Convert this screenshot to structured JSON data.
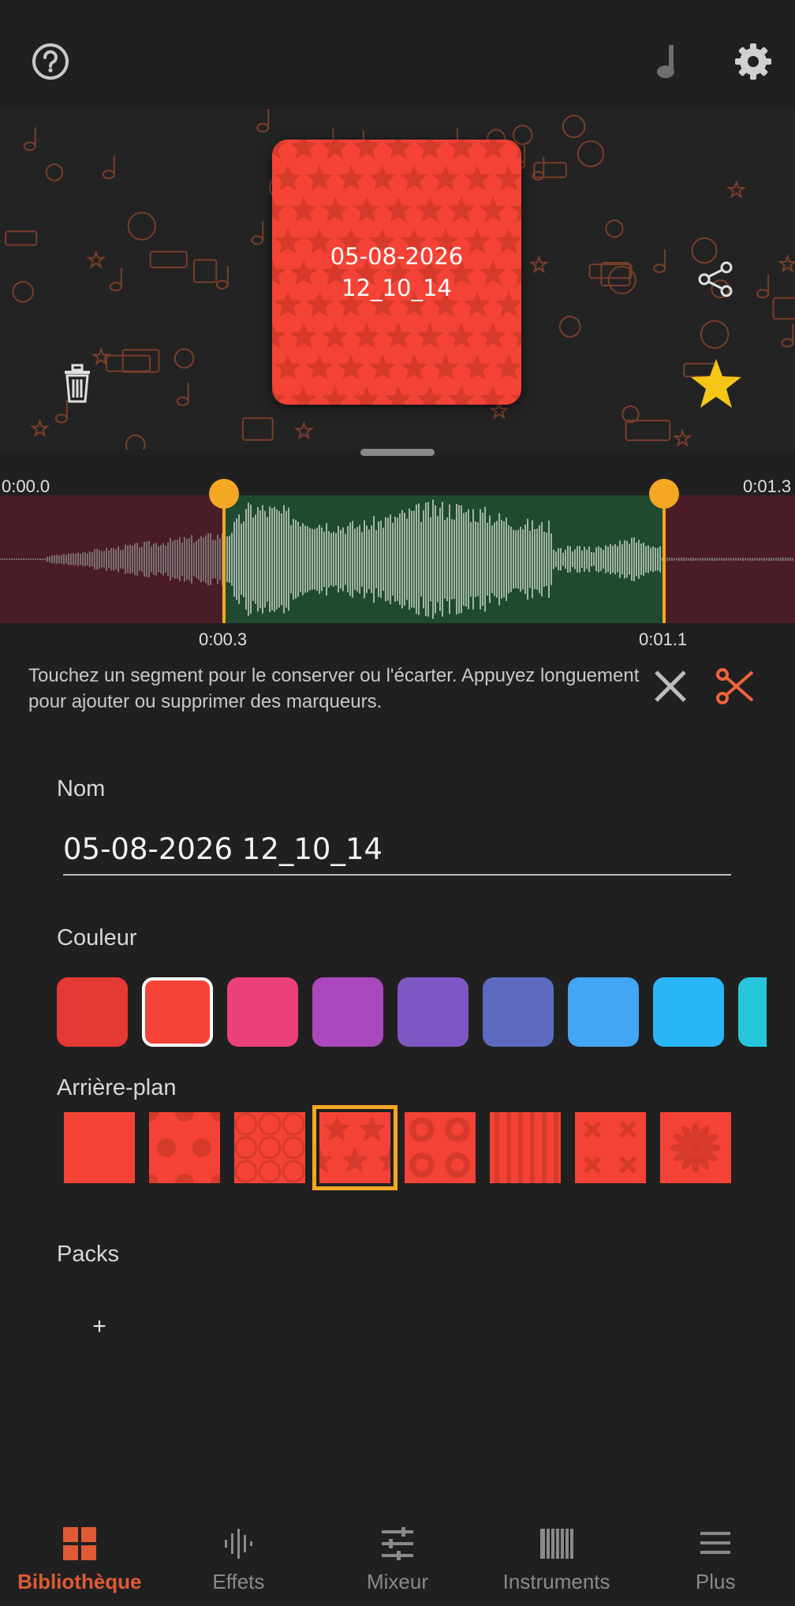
{
  "colors": {
    "accent": "#f5a623",
    "nav_active": "#e05a35",
    "cover_red": "#f44336",
    "keep_segment": "#1f4a30",
    "discard_segment": "#4a1d26",
    "scissors": "#f0643c",
    "star": "#f5c518"
  },
  "top_bar": {
    "help_icon": "help-circle-icon",
    "music_icon": "music-note-icon",
    "settings_icon": "gear-icon"
  },
  "hero": {
    "cover_line1": "05-08-2026",
    "cover_line2": "12_10_14",
    "delete_icon": "trash-icon",
    "share_icon": "share-icon",
    "favorite_icon": "star-icon"
  },
  "trim": {
    "start_time": "0:00.0",
    "end_time": "0:01.3",
    "marker_left_time": "0:00.3",
    "marker_right_time": "0:01.1",
    "hint": "Touchez un segment pour le conserver ou l'écarter. Appuyez longuement pour ajouter ou supprimer des marqueurs.",
    "cancel_icon": "close-icon",
    "cut_icon": "scissors-icon"
  },
  "form": {
    "name_label": "Nom",
    "name_value": "05-08-2026 12_10_14",
    "color_label": "Couleur",
    "colors": [
      "#e53935",
      "#f44336",
      "#ec407a",
      "#ab47bc",
      "#7e57c2",
      "#5c6bc0",
      "#42a5f5",
      "#29b6f6",
      "#26c6da"
    ],
    "selected_color_index": 1,
    "background_label": "Arrière-plan",
    "backgrounds": [
      "plain",
      "dots",
      "tiles",
      "stars",
      "circles",
      "stripes",
      "crosses",
      "flower"
    ],
    "selected_background_index": 3,
    "packs_label": "Packs",
    "packs_add": "+"
  },
  "nav": {
    "items": [
      {
        "label": "Bibliothèque",
        "icon": "grid-icon",
        "active": true
      },
      {
        "label": "Effets",
        "icon": "waveform-icon",
        "active": false
      },
      {
        "label": "Mixeur",
        "icon": "sliders-icon",
        "active": false
      },
      {
        "label": "Instruments",
        "icon": "piano-icon",
        "active": false
      },
      {
        "label": "Plus",
        "icon": "menu-icon",
        "active": false
      }
    ]
  }
}
